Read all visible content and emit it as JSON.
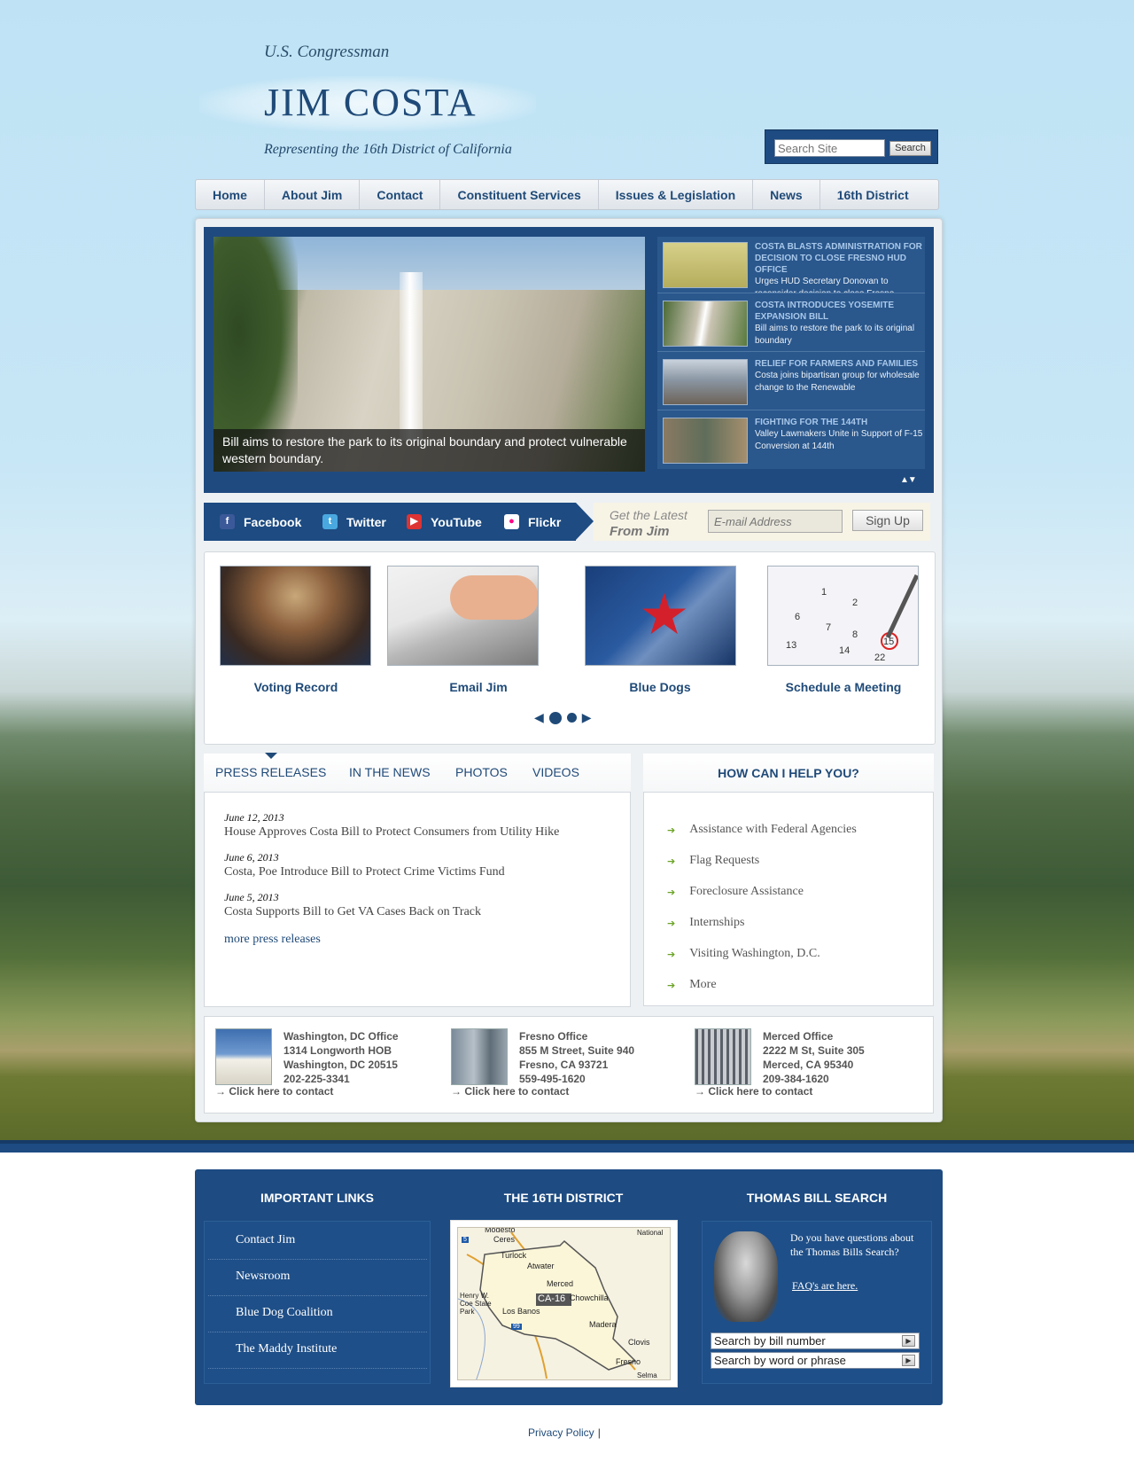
{
  "header": {
    "subtitle": "U.S. Congressman",
    "title": "JIM COSTA",
    "tagline": "Representing the 16th District of California"
  },
  "search": {
    "placeholder": "Search Site",
    "button_label": "Search"
  },
  "nav": {
    "items": [
      "Home",
      "About Jim",
      "Contact",
      "Constituent Services",
      "Issues & Legislation",
      "News",
      "16th District"
    ]
  },
  "slider": {
    "caption": "Bill aims to restore the park to its original boundary and protect vulnerable western boundary.",
    "news": [
      {
        "title": "COSTA BLASTS ADMINISTRATION FOR DECISION TO CLOSE FRESNO HUD OFFICE",
        "desc": "Urges HUD Secretary Donovan to reconsider decision to close Fresno"
      },
      {
        "title": "COSTA INTRODUCES YOSEMITE EXPANSION BILL",
        "desc": "Bill aims to restore the park to its original boundary"
      },
      {
        "title": "RELIEF FOR FARMERS AND FAMILIES",
        "desc": "Costa joins bipartisan group for wholesale change to the Renewable"
      },
      {
        "title": "FIGHTING FOR THE 144TH",
        "desc": "Valley Lawmakers Unite in Support of F-15 Conversion at 144th"
      }
    ],
    "arrows": "▲▼"
  },
  "social": {
    "links": [
      "Facebook",
      "Twitter",
      "YouTube",
      "Flickr"
    ],
    "latest_line1": "Get the Latest",
    "latest_line2": "From Jim",
    "email_placeholder": "E-mail Address",
    "signup_label": "Sign Up"
  },
  "features": {
    "items": [
      "Voting Record",
      "Email Jim",
      "Blue Dogs",
      "Schedule a Meeting"
    ],
    "pager_prev": "◀",
    "pager_next": "▶"
  },
  "press": {
    "tabs": [
      "PRESS RELEASES",
      "IN THE NEWS",
      "PHOTOS",
      "VIDEOS"
    ],
    "items": [
      {
        "date": "June 12, 2013",
        "title": "House Approves Costa Bill to Protect Consumers from Utility Hike"
      },
      {
        "date": "June 6, 2013",
        "title": "Costa, Poe Introduce Bill to Protect Crime Victims Fund"
      },
      {
        "date": "June 5, 2013",
        "title": "Costa Supports Bill to Get VA Cases Back on Track"
      }
    ],
    "more": "more press releases"
  },
  "help": {
    "heading": "HOW CAN I HELP YOU?",
    "items": [
      "Assistance with Federal Agencies",
      "Flag Requests",
      "Foreclosure Assistance",
      "Internships",
      "Visiting Washington, D.C.",
      "More"
    ],
    "arrow": "➔"
  },
  "offices": [
    {
      "name": "Washington, DC Office",
      "line1": "1314 Longworth HOB",
      "line2": "Washington, DC 20515",
      "phone": "202-225-3341",
      "link": "→ Click here to contact"
    },
    {
      "name": "Fresno Office",
      "line1": "855 M Street, Suite 940",
      "line2": "Fresno, CA 93721",
      "phone": "559-495-1620",
      "link": "→ Click here to contact"
    },
    {
      "name": "Merced Office",
      "line1": "2222 M St, Suite 305",
      "line2": "Merced, CA 95340",
      "phone": "209-384-1620",
      "link": "→ Click here to contact"
    }
  ],
  "footer": {
    "important_links_heading": "IMPORTANT LINKS",
    "important_links": [
      "Contact Jim",
      "Newsroom",
      "Blue Dog Coalition",
      "The Maddy Institute"
    ],
    "district_heading": "THE 16TH DISTRICT",
    "map_labels": [
      "Modesto",
      "Ceres",
      "Turlock",
      "Atwater",
      "Merced",
      "CA-16",
      "Chowchilla",
      "Los Banos",
      "Henry W. Coe State Park",
      "Madera",
      "Clovis",
      "Fresno",
      "Selma",
      "National",
      "5",
      "99"
    ],
    "thomas_heading": "THOMAS BILL SEARCH",
    "thomas_text": "Do you have questions about the Thomas Bills Search?",
    "thomas_link": "FAQ's are here.",
    "bill_number_placeholder": "Search by bill number",
    "bill_word_placeholder": "Search by word or phrase",
    "go_icon": "▶"
  },
  "bottom": {
    "privacy": "Privacy Policy",
    "separator": "|"
  },
  "colors": {
    "brand_blue": "#1d4b82",
    "link_blue": "#1f4a78",
    "help_arrow_green": "#6aa324"
  }
}
